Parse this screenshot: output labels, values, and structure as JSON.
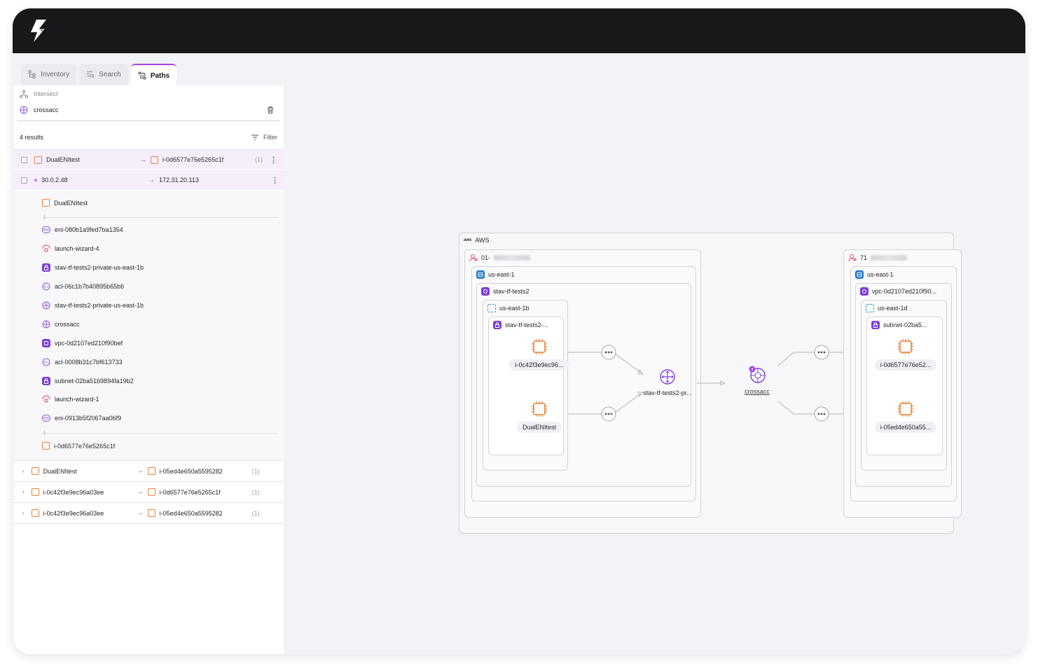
{
  "tabs": [
    {
      "label": "Inventory",
      "icon": "tree-icon"
    },
    {
      "label": "Search",
      "icon": "search-list-icon"
    },
    {
      "label": "Paths",
      "icon": "paths-icon",
      "active": true
    }
  ],
  "query": {
    "intersect_label": "Intersect",
    "target": "crossacc"
  },
  "results": {
    "count_label": "4 results",
    "filter_label": "Filter",
    "rows": [
      {
        "source": "DualENItest",
        "dest": "i-0d6577e76e5265c1f",
        "count": "(1)"
      },
      {
        "source": "DualENItest",
        "dest": "i-05ed4e650a5595282",
        "count": "(1)"
      },
      {
        "source": "i-0c42f3e9ec96a03ee",
        "dest": "i-0d6577e76e5265c1f",
        "count": "(1)"
      },
      {
        "source": "i-0c42f3e9ec96a03ee",
        "dest": "i-05ed4e650a5595282",
        "count": "(1)"
      }
    ],
    "sub_row": {
      "source_ip": "30.0.2.48",
      "dest_ip": "172.31.20.113"
    },
    "path_steps": [
      "DualENItest",
      "eni-080b1a9fed7ba1354",
      "launch-wizard-4",
      "stav-tf-tests2-private-us-east-1b",
      "acl-06c1b7b40895b65b6",
      "stav-tf-tests2-private-us-east-1b",
      "crossacc",
      "vpc-0d2107ed210f90bef",
      "acl-0008b31c7bf613733",
      "subnet-02ba51b9894fa19b2",
      "launch-wizard-1",
      "eni-0913b5f2067aa06f9",
      "i-0d6577e76e5265c1f"
    ]
  },
  "diagram": {
    "cloud": "AWS",
    "left_account": {
      "id": "01-",
      "region": "us-east-1",
      "vpc": "stav-tf-tests2",
      "az": "us-east-1b",
      "subnet": "stav-tf-tests2-...",
      "instances": [
        "i-0c42f3e9ec96...",
        "DualENItest"
      ],
      "router": "stav-tf-tests2-pr..."
    },
    "gateway": "crossacc",
    "right_account": {
      "id": "71",
      "region": "us-east-1",
      "vpc": "vpc-0d2107ed210f90...",
      "az": "us-east-1d",
      "subnet": "subnet-02ba5...",
      "instances": [
        "i-0d6577e76e52...",
        "i-05ed4e650a55..."
      ]
    }
  },
  "colors": {
    "accent": "#a445e8",
    "instance": "#e8843a",
    "vpc": "#7b3fd4",
    "region": "#1f78c8",
    "topbar": "#18181b"
  }
}
